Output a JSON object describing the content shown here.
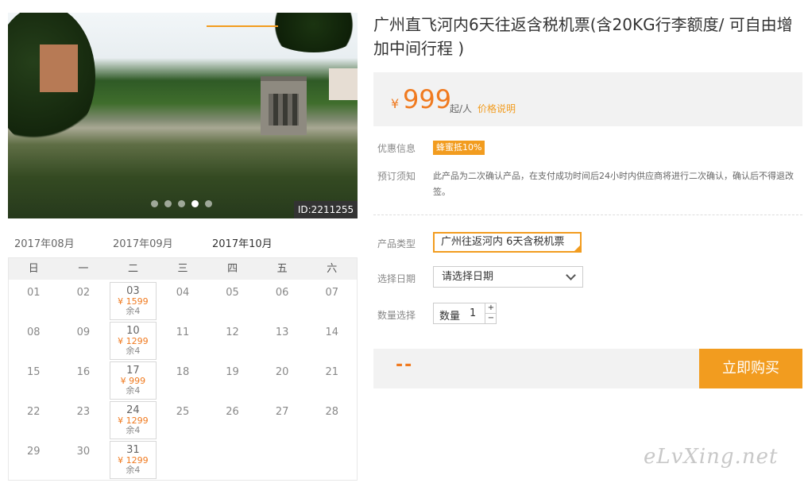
{
  "gallery": {
    "id_tag": "ID:2211255",
    "dots": 5,
    "active_dot": 4
  },
  "calendar": {
    "months": [
      "2017年08月",
      "2017年09月",
      "2017年10月"
    ],
    "active_month": "2017年10月",
    "weekdays": [
      "日",
      "一",
      "二",
      "三",
      "四",
      "五",
      "六"
    ],
    "days": [
      {
        "d": "01"
      },
      {
        "d": "02"
      },
      {
        "d": "03",
        "price": "¥ 1599",
        "stock": "余4"
      },
      {
        "d": "04"
      },
      {
        "d": "05"
      },
      {
        "d": "06"
      },
      {
        "d": "07"
      },
      {
        "d": "08"
      },
      {
        "d": "09"
      },
      {
        "d": "10",
        "price": "¥ 1299",
        "stock": "余4"
      },
      {
        "d": "11"
      },
      {
        "d": "12"
      },
      {
        "d": "13"
      },
      {
        "d": "14"
      },
      {
        "d": "15"
      },
      {
        "d": "16"
      },
      {
        "d": "17",
        "price": "¥ 999",
        "stock": "余4"
      },
      {
        "d": "18"
      },
      {
        "d": "19"
      },
      {
        "d": "20"
      },
      {
        "d": "21"
      },
      {
        "d": "22"
      },
      {
        "d": "23"
      },
      {
        "d": "24",
        "price": "¥ 1299",
        "stock": "余4"
      },
      {
        "d": "25"
      },
      {
        "d": "26"
      },
      {
        "d": "27"
      },
      {
        "d": "28"
      },
      {
        "d": "29"
      },
      {
        "d": "30"
      },
      {
        "d": "31",
        "price": "¥ 1299",
        "stock": "余4"
      }
    ]
  },
  "product": {
    "title": "广州直飞河内6天往返含税机票(含20KG行李额度/ 可自由增加中间行程 )",
    "price_symbol": "¥",
    "price": "999",
    "price_unit": "起/人",
    "price_explain": "价格说明",
    "promo_label": "优惠信息",
    "promo_badge": "蜂蜜抵10%",
    "notice_label": "预订须知",
    "notice_text": "此产品为二次确认产品，在支付成功时间后24小时内供应商将进行二次确认，确认后不得退改签。",
    "type_label": "产品类型",
    "type_value": "广州往返河内 6天含税机票",
    "date_label": "选择日期",
    "date_placeholder": "请选择日期",
    "qty_label": "数量选择",
    "qty_inner_label": "数量",
    "qty_value": "1",
    "qty_plus": "+",
    "qty_minus": "−",
    "total": "--",
    "buy_label": "立即购买"
  },
  "watermark": "eLvXing.net",
  "colors": {
    "accent": "#f29c1f",
    "price": "#f07a1f"
  }
}
